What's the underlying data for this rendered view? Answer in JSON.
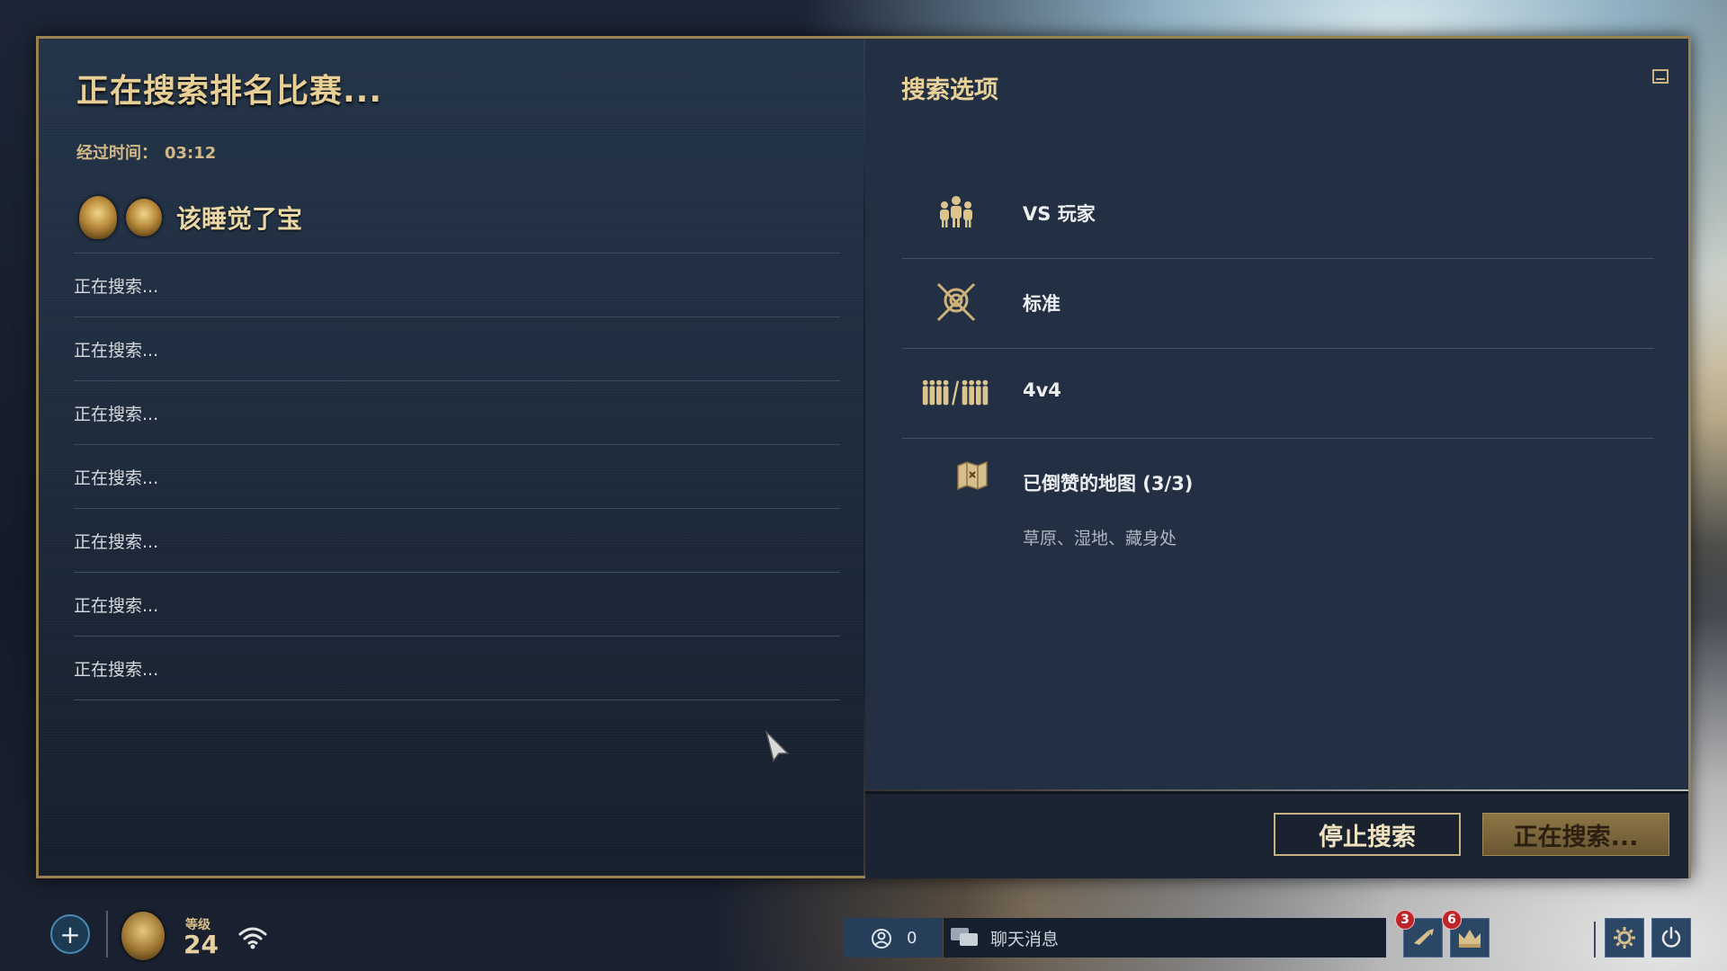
{
  "search": {
    "title": "正在搜索排名比赛...",
    "elapsed_label": "经过时间：",
    "elapsed_value": "03:12",
    "player_name": "该睡觉了宝",
    "slots": [
      "正在搜索...",
      "正在搜索...",
      "正在搜索...",
      "正在搜索...",
      "正在搜索...",
      "正在搜索...",
      "正在搜索..."
    ]
  },
  "options": {
    "title": "搜索选项",
    "items": [
      {
        "icon": "players-icon",
        "label": "VS 玩家"
      },
      {
        "icon": "crossed-swords-icon",
        "label": "标准"
      },
      {
        "icon": "team-size-icon",
        "label": "4v4"
      },
      {
        "icon": "map-icon",
        "label": "已倒赞的地图 (3/3)",
        "sub": "草原、湿地、藏身处"
      }
    ]
  },
  "buttons": {
    "stop": "停止搜索",
    "searching": "正在搜索..."
  },
  "bottom": {
    "level_label": "等级",
    "level_value": "24",
    "friends_count": "0",
    "chat_placeholder": "聊天消息",
    "notif1_count": "3",
    "notif2_count": "6"
  },
  "colors": {
    "gold_accent": "#e7cf96",
    "frame": "#9a8150",
    "button_gold": "#8c7546"
  }
}
